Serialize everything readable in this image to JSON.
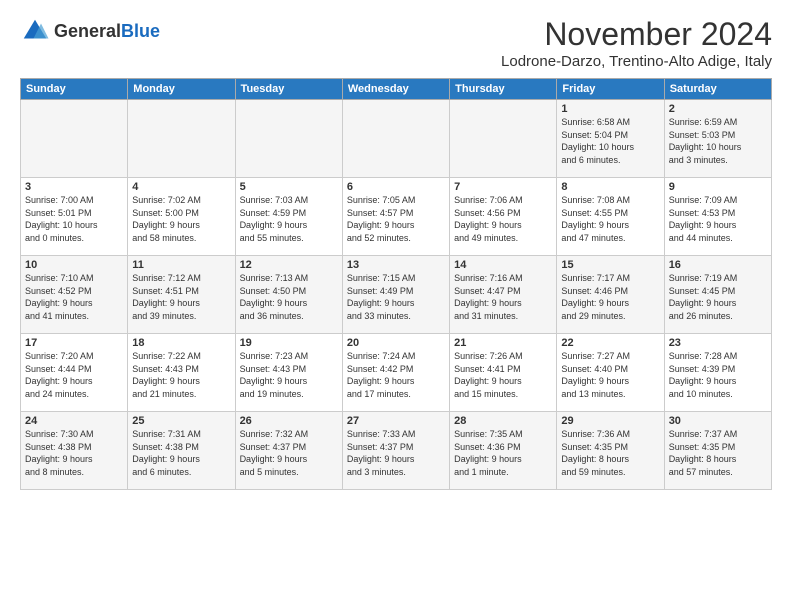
{
  "logo": {
    "text_general": "General",
    "text_blue": "Blue"
  },
  "header": {
    "month": "November 2024",
    "location": "Lodrone-Darzo, Trentino-Alto Adige, Italy"
  },
  "weekdays": [
    "Sunday",
    "Monday",
    "Tuesday",
    "Wednesday",
    "Thursday",
    "Friday",
    "Saturday"
  ],
  "weeks": [
    [
      {
        "day": "",
        "info": ""
      },
      {
        "day": "",
        "info": ""
      },
      {
        "day": "",
        "info": ""
      },
      {
        "day": "",
        "info": ""
      },
      {
        "day": "",
        "info": ""
      },
      {
        "day": "1",
        "info": "Sunrise: 6:58 AM\nSunset: 5:04 PM\nDaylight: 10 hours\nand 6 minutes."
      },
      {
        "day": "2",
        "info": "Sunrise: 6:59 AM\nSunset: 5:03 PM\nDaylight: 10 hours\nand 3 minutes."
      }
    ],
    [
      {
        "day": "3",
        "info": "Sunrise: 7:00 AM\nSunset: 5:01 PM\nDaylight: 10 hours\nand 0 minutes."
      },
      {
        "day": "4",
        "info": "Sunrise: 7:02 AM\nSunset: 5:00 PM\nDaylight: 9 hours\nand 58 minutes."
      },
      {
        "day": "5",
        "info": "Sunrise: 7:03 AM\nSunset: 4:59 PM\nDaylight: 9 hours\nand 55 minutes."
      },
      {
        "day": "6",
        "info": "Sunrise: 7:05 AM\nSunset: 4:57 PM\nDaylight: 9 hours\nand 52 minutes."
      },
      {
        "day": "7",
        "info": "Sunrise: 7:06 AM\nSunset: 4:56 PM\nDaylight: 9 hours\nand 49 minutes."
      },
      {
        "day": "8",
        "info": "Sunrise: 7:08 AM\nSunset: 4:55 PM\nDaylight: 9 hours\nand 47 minutes."
      },
      {
        "day": "9",
        "info": "Sunrise: 7:09 AM\nSunset: 4:53 PM\nDaylight: 9 hours\nand 44 minutes."
      }
    ],
    [
      {
        "day": "10",
        "info": "Sunrise: 7:10 AM\nSunset: 4:52 PM\nDaylight: 9 hours\nand 41 minutes."
      },
      {
        "day": "11",
        "info": "Sunrise: 7:12 AM\nSunset: 4:51 PM\nDaylight: 9 hours\nand 39 minutes."
      },
      {
        "day": "12",
        "info": "Sunrise: 7:13 AM\nSunset: 4:50 PM\nDaylight: 9 hours\nand 36 minutes."
      },
      {
        "day": "13",
        "info": "Sunrise: 7:15 AM\nSunset: 4:49 PM\nDaylight: 9 hours\nand 33 minutes."
      },
      {
        "day": "14",
        "info": "Sunrise: 7:16 AM\nSunset: 4:47 PM\nDaylight: 9 hours\nand 31 minutes."
      },
      {
        "day": "15",
        "info": "Sunrise: 7:17 AM\nSunset: 4:46 PM\nDaylight: 9 hours\nand 29 minutes."
      },
      {
        "day": "16",
        "info": "Sunrise: 7:19 AM\nSunset: 4:45 PM\nDaylight: 9 hours\nand 26 minutes."
      }
    ],
    [
      {
        "day": "17",
        "info": "Sunrise: 7:20 AM\nSunset: 4:44 PM\nDaylight: 9 hours\nand 24 minutes."
      },
      {
        "day": "18",
        "info": "Sunrise: 7:22 AM\nSunset: 4:43 PM\nDaylight: 9 hours\nand 21 minutes."
      },
      {
        "day": "19",
        "info": "Sunrise: 7:23 AM\nSunset: 4:43 PM\nDaylight: 9 hours\nand 19 minutes."
      },
      {
        "day": "20",
        "info": "Sunrise: 7:24 AM\nSunset: 4:42 PM\nDaylight: 9 hours\nand 17 minutes."
      },
      {
        "day": "21",
        "info": "Sunrise: 7:26 AM\nSunset: 4:41 PM\nDaylight: 9 hours\nand 15 minutes."
      },
      {
        "day": "22",
        "info": "Sunrise: 7:27 AM\nSunset: 4:40 PM\nDaylight: 9 hours\nand 13 minutes."
      },
      {
        "day": "23",
        "info": "Sunrise: 7:28 AM\nSunset: 4:39 PM\nDaylight: 9 hours\nand 10 minutes."
      }
    ],
    [
      {
        "day": "24",
        "info": "Sunrise: 7:30 AM\nSunset: 4:38 PM\nDaylight: 9 hours\nand 8 minutes."
      },
      {
        "day": "25",
        "info": "Sunrise: 7:31 AM\nSunset: 4:38 PM\nDaylight: 9 hours\nand 6 minutes."
      },
      {
        "day": "26",
        "info": "Sunrise: 7:32 AM\nSunset: 4:37 PM\nDaylight: 9 hours\nand 5 minutes."
      },
      {
        "day": "27",
        "info": "Sunrise: 7:33 AM\nSunset: 4:37 PM\nDaylight: 9 hours\nand 3 minutes."
      },
      {
        "day": "28",
        "info": "Sunrise: 7:35 AM\nSunset: 4:36 PM\nDaylight: 9 hours\nand 1 minute."
      },
      {
        "day": "29",
        "info": "Sunrise: 7:36 AM\nSunset: 4:35 PM\nDaylight: 8 hours\nand 59 minutes."
      },
      {
        "day": "30",
        "info": "Sunrise: 7:37 AM\nSunset: 4:35 PM\nDaylight: 8 hours\nand 57 minutes."
      }
    ]
  ]
}
